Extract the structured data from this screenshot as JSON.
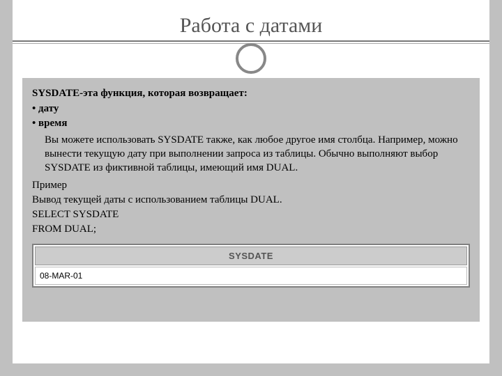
{
  "title": "Работа с датами",
  "heading": "SYSDATE-эта функция, которая возвращает:",
  "bullets": [
    "дату",
    "время"
  ],
  "paragraph": "Вы можете использовать SYSDATE также, как любое другое имя столбца. Например, можно вынести текущую дату при выполнении запроса из таблицы. Обычно выполняют выбор SYSDATE из фиктивной таблицы, имеющий имя DUAL.",
  "example_label": "Пример",
  "example_desc": "Вывод текущей даты с использованием таблицы DUAL.",
  "sql_line1": "SELECT SYSDATE",
  "sql_line2": "FROM DUAL;",
  "table": {
    "header": "SYSDATE",
    "value": "08-MAR-01"
  }
}
